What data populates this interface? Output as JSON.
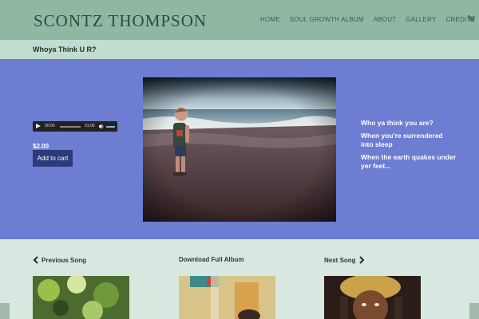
{
  "header": {
    "site_title": "SCONTZ THOMPSON",
    "nav": [
      "HOME",
      "SOUL GROWTH ALBUM",
      "ABOUT",
      "GALLERY",
      "CREDITS"
    ],
    "cart_icon": "cart-icon"
  },
  "page": {
    "title": "Whoya Think U R?"
  },
  "player": {
    "current_time": "00:00",
    "duration": "01:00"
  },
  "product": {
    "price": "$2.00",
    "add_to_cart_label": "Add to cart"
  },
  "lyrics": [
    "Who ya think you are?",
    "When you're surrendered into sleep",
    "When the earth quakes under yer feet..."
  ],
  "song_nav": {
    "previous_label": "Previous Song",
    "download_label": "Download Full Album",
    "next_label": "Next Song"
  },
  "colors": {
    "header_bg": "#8fb8a3",
    "titlebar_bg": "#c2ddd0",
    "hero_bg": "#6c7dd2",
    "button_bg": "#2c3a7a"
  }
}
